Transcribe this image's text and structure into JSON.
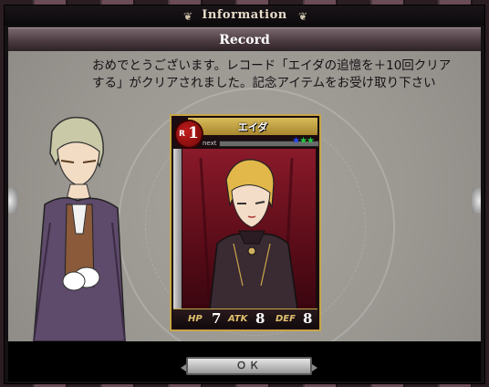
{
  "dialog": {
    "title": "Information",
    "subtitle": "Record",
    "message": "おめでとうございます。レコード「エイダの追憶を＋10回クリアする」がクリアされました。記念アイテムをお受け取り下さい",
    "ok_label": "ＯＫ"
  },
  "card": {
    "name": "エイダ",
    "rarity_letter": "R",
    "level": "1",
    "next_label": "next",
    "stars": "★★★",
    "star_colors": [
      "#2a4aff",
      "#22cc44",
      "#22cc44"
    ],
    "stats": [
      {
        "label": "HP",
        "value": "7"
      },
      {
        "label": "ATK",
        "value": "8"
      },
      {
        "label": "DEF",
        "value": "8"
      }
    ]
  },
  "colors": {
    "frame_gold": "#c6a646",
    "content_bg": "#9b9892",
    "card_red": "#8a1a2a"
  },
  "icons": {
    "title_ornament_left": "scroll-ornament-icon",
    "title_ornament_right": "scroll-ornament-icon"
  }
}
